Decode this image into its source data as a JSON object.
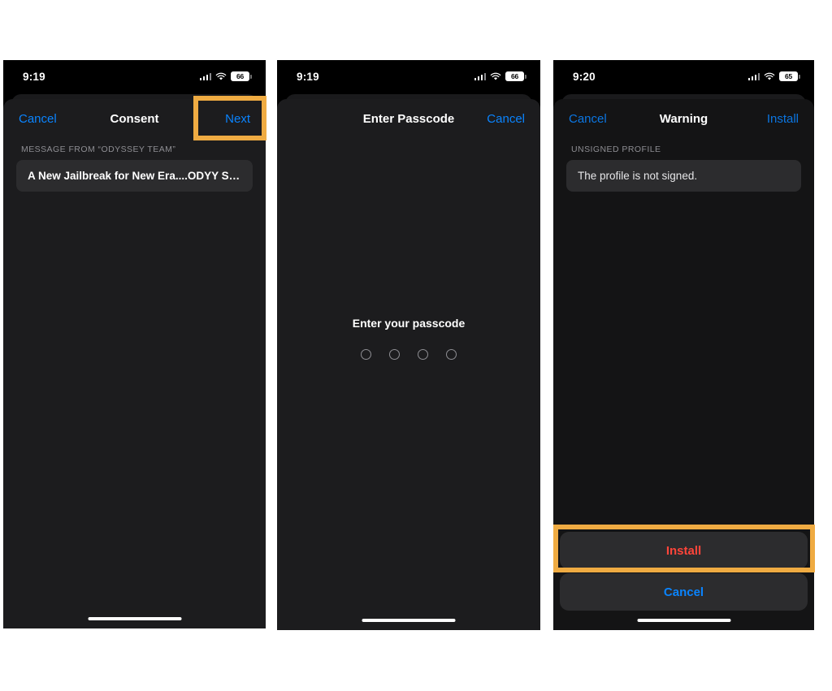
{
  "screens": [
    {
      "id": "consent",
      "status": {
        "time": "9:19",
        "battery_level": "66",
        "signal_icon": "cellular-signal-icon",
        "wifi_icon": "wifi-icon",
        "battery_icon": "battery-icon"
      },
      "nav": {
        "left_label": "Cancel",
        "title": "Consent",
        "right_label": "Next"
      },
      "section_label": "MESSAGE FROM “ODYSSEY TEAM”",
      "message": "A New Jailbreak for New Era....ODYY Store,"
    },
    {
      "id": "passcode",
      "status": {
        "time": "9:19",
        "battery_level": "66",
        "signal_icon": "cellular-signal-icon",
        "wifi_icon": "wifi-icon",
        "battery_icon": "battery-icon"
      },
      "nav": {
        "title": "Enter Passcode",
        "right_label": "Cancel"
      },
      "prompt": "Enter your passcode",
      "dot_count": 4
    },
    {
      "id": "warning",
      "status": {
        "time": "9:20",
        "battery_level": "65",
        "signal_icon": "cellular-signal-icon",
        "wifi_icon": "wifi-icon",
        "battery_icon": "battery-icon"
      },
      "nav": {
        "left_label": "Cancel",
        "title": "Warning",
        "right_label": "Install"
      },
      "section_label": "UNSIGNED PROFILE",
      "message": "The profile is not signed.",
      "actions": {
        "install_label": "Install",
        "cancel_label": "Cancel"
      }
    }
  ],
  "annotations": {
    "highlight_color": "#efab42",
    "targets": [
      "next-button",
      "install-button"
    ]
  }
}
